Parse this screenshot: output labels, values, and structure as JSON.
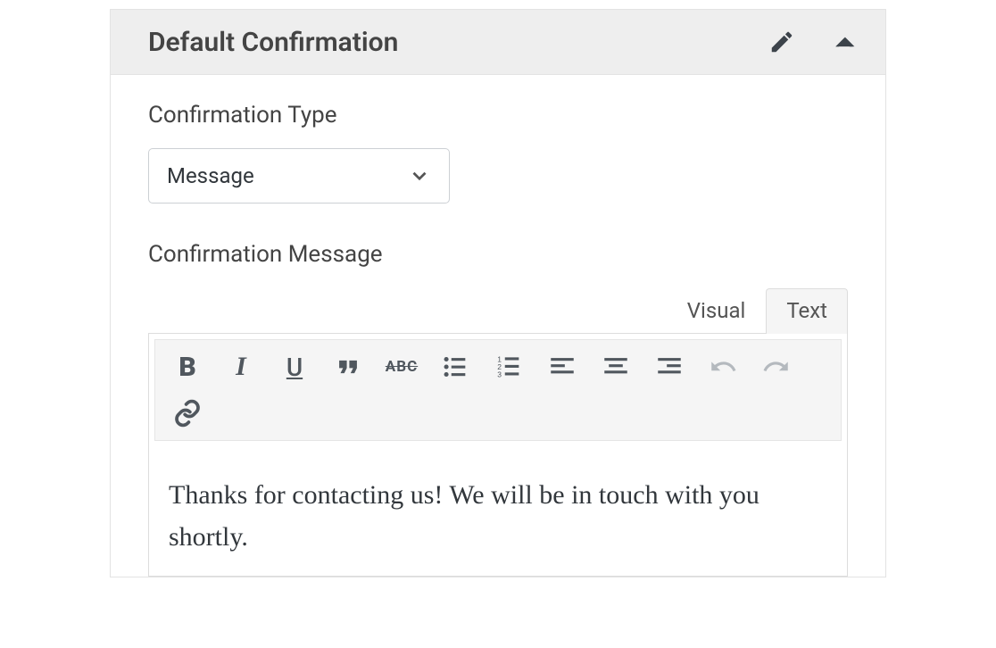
{
  "panel": {
    "title": "Default Confirmation"
  },
  "labels": {
    "confirmation_type": "Confirmation Type",
    "confirmation_message": "Confirmation Message"
  },
  "select": {
    "value": "Message"
  },
  "tabs": {
    "visual": "Visual",
    "text": "Text"
  },
  "editor": {
    "content": "Thanks for contacting us! We will be in touch with you shortly."
  },
  "toolbar": {
    "strike_label": "ABC"
  }
}
